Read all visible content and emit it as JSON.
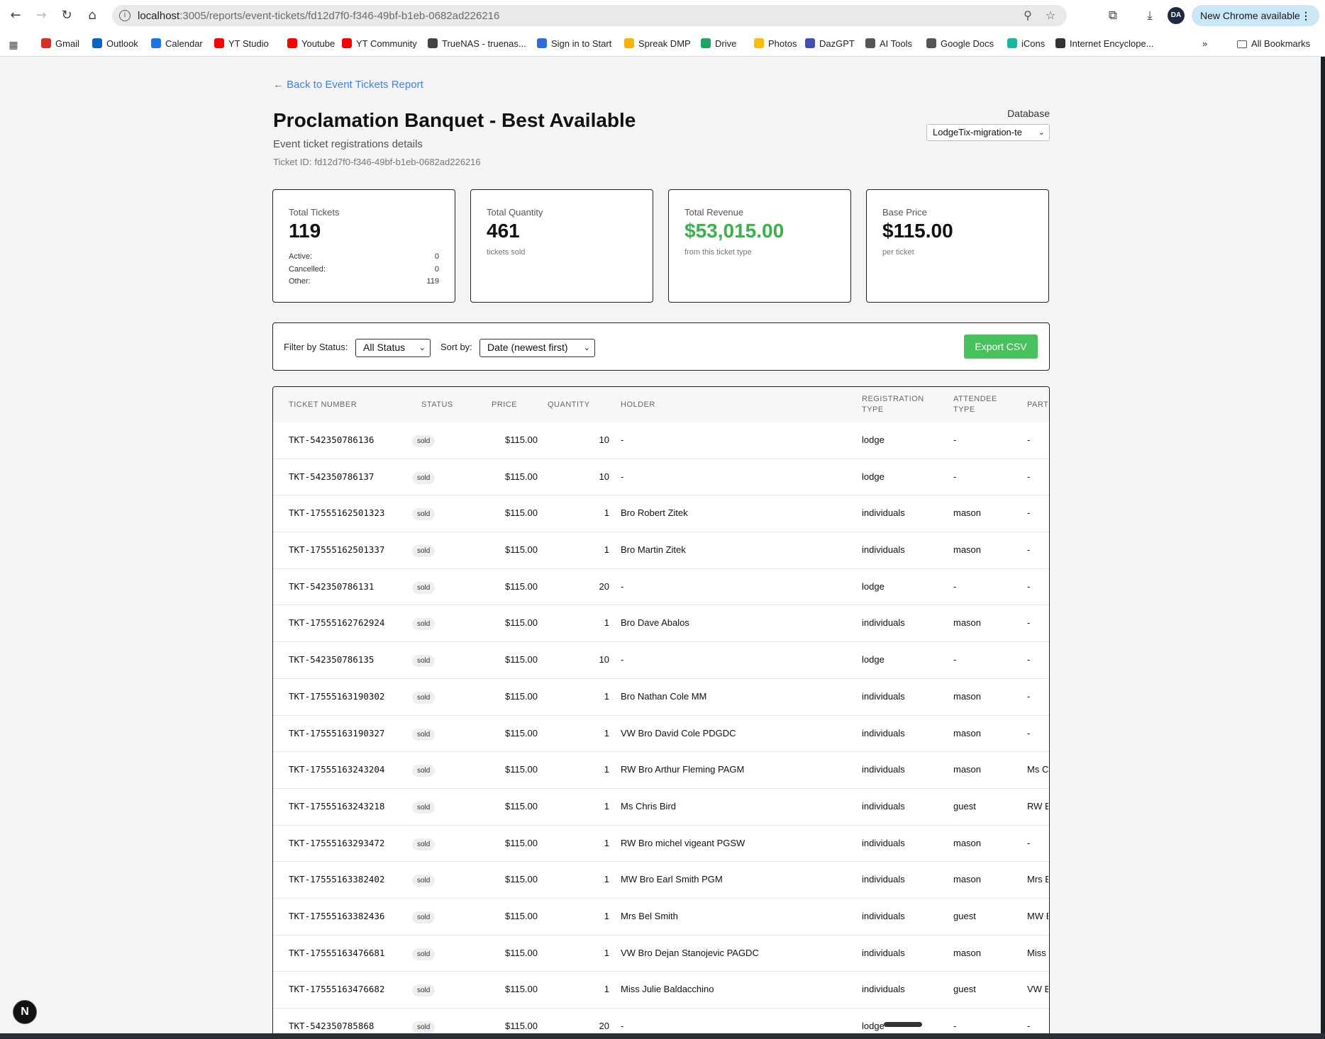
{
  "browser": {
    "url_host": "localhost",
    "url_path": ":3005/reports/event-tickets/fd12d7f0-f346-49bf-b1eb-0682ad226216",
    "update_label": "New Chrome available",
    "profile_initials": "DA"
  },
  "bookmarks": [
    {
      "label": "Gmail",
      "icon": "gmail-icon",
      "color": "#d93025"
    },
    {
      "label": "Outlook",
      "icon": "outlook-icon",
      "color": "#0a64c8"
    },
    {
      "label": "Calendar",
      "icon": "calendar-icon",
      "color": "#1a73e8"
    },
    {
      "label": "YT Studio",
      "icon": "youtube-studio-icon",
      "color": "#ff0000"
    },
    {
      "label": "Youtube",
      "icon": "youtube-icon",
      "color": "#ff0000"
    },
    {
      "label": "YT Community",
      "icon": "youtube-community-icon",
      "color": "#ff0000"
    },
    {
      "label": "TrueNAS - truenas...",
      "icon": "truenas-icon",
      "color": "#444444"
    },
    {
      "label": "Sign in to Start",
      "icon": "zoom-icon",
      "color": "#2d6cdf"
    },
    {
      "label": "Spreak DMP",
      "icon": "spreak-icon",
      "color": "#f5b400"
    },
    {
      "label": "Drive",
      "icon": "drive-icon",
      "color": "#1fa463"
    },
    {
      "label": "Photos",
      "icon": "photos-icon",
      "color": "#fbbc04"
    },
    {
      "label": "DazGPT",
      "icon": "dazgpt-icon",
      "color": "#3f51b5"
    },
    {
      "label": "AI Tools",
      "icon": "folder-icon",
      "color": "#555555"
    },
    {
      "label": "Google Docs",
      "icon": "folder-icon",
      "color": "#555555"
    },
    {
      "label": "iCons",
      "icon": "icons-icon",
      "color": "#18b8a0"
    },
    {
      "label": "Internet Encyclope...",
      "icon": "encyclopedia-icon",
      "color": "#333333"
    }
  ],
  "bookmarks_more": "»",
  "all_bookmarks": "All Bookmarks",
  "page": {
    "back_link": "← Back to Event Tickets Report",
    "title": "Proclamation Banquet - Best Available",
    "subtitle": "Event ticket registrations details",
    "ticket_id_label": "Ticket ID:",
    "ticket_id": "fd12d7f0-f346-49bf-b1eb-0682ad226216",
    "database_label": "Database",
    "database_value": "LodgeTix-migration-te"
  },
  "cards": {
    "total_tickets": {
      "label": "Total Tickets",
      "value": "119",
      "active_label": "Active:",
      "active": "0",
      "cancelled_label": "Cancelled:",
      "cancelled": "0",
      "other_label": "Other:",
      "other": "119"
    },
    "total_quantity": {
      "label": "Total Quantity",
      "value": "461",
      "sub": "tickets sold"
    },
    "total_revenue": {
      "label": "Total Revenue",
      "value": "$53,015.00",
      "sub": "from this ticket type",
      "color": "#38b24a"
    },
    "base_price": {
      "label": "Base Price",
      "value": "$115.00",
      "sub": "per ticket"
    }
  },
  "filters": {
    "status_label": "Filter by Status:",
    "status_value": "All Status",
    "sort_label": "Sort by:",
    "sort_value": "Date (newest first)",
    "export_label": "Export CSV",
    "export_color": "#46c15c"
  },
  "table": {
    "headers": {
      "ticket_number": "TICKET NUMBER",
      "status": "STATUS",
      "price": "PRICE",
      "quantity": "QUANTITY",
      "holder": "HOLDER",
      "registration_type_1": "REGISTRATION",
      "registration_type_2": "TYPE",
      "attendee_type_1": "ATTENDEE",
      "attendee_type_2": "TYPE",
      "partner": "PART"
    },
    "rows": [
      {
        "ticket": "TKT-542350786136",
        "status": "sold",
        "price": "$115.00",
        "qty": "10",
        "holder": "-",
        "reg": "lodge",
        "att": "-",
        "part": "-"
      },
      {
        "ticket": "TKT-542350786137",
        "status": "sold",
        "price": "$115.00",
        "qty": "10",
        "holder": "-",
        "reg": "lodge",
        "att": "-",
        "part": "-"
      },
      {
        "ticket": "TKT-17555162501323",
        "status": "sold",
        "price": "$115.00",
        "qty": "1",
        "holder": "Bro Robert Zitek",
        "reg": "individuals",
        "att": "mason",
        "part": "-"
      },
      {
        "ticket": "TKT-17555162501337",
        "status": "sold",
        "price": "$115.00",
        "qty": "1",
        "holder": "Bro Martin Zitek",
        "reg": "individuals",
        "att": "mason",
        "part": "-"
      },
      {
        "ticket": "TKT-542350786131",
        "status": "sold",
        "price": "$115.00",
        "qty": "20",
        "holder": "-",
        "reg": "lodge",
        "att": "-",
        "part": "-"
      },
      {
        "ticket": "TKT-17555162762924",
        "status": "sold",
        "price": "$115.00",
        "qty": "1",
        "holder": "Bro Dave Abalos",
        "reg": "individuals",
        "att": "mason",
        "part": "-"
      },
      {
        "ticket": "TKT-542350786135",
        "status": "sold",
        "price": "$115.00",
        "qty": "10",
        "holder": "-",
        "reg": "lodge",
        "att": "-",
        "part": "-"
      },
      {
        "ticket": "TKT-17555163190302",
        "status": "sold",
        "price": "$115.00",
        "qty": "1",
        "holder": "Bro Nathan Cole MM",
        "reg": "individuals",
        "att": "mason",
        "part": "-"
      },
      {
        "ticket": "TKT-17555163190327",
        "status": "sold",
        "price": "$115.00",
        "qty": "1",
        "holder": "VW Bro David Cole PDGDC",
        "reg": "individuals",
        "att": "mason",
        "part": "-"
      },
      {
        "ticket": "TKT-17555163243204",
        "status": "sold",
        "price": "$115.00",
        "qty": "1",
        "holder": "RW Bro Arthur Fleming PAGM",
        "reg": "individuals",
        "att": "mason",
        "part": "Ms C"
      },
      {
        "ticket": "TKT-17555163243218",
        "status": "sold",
        "price": "$115.00",
        "qty": "1",
        "holder": "Ms Chris Bird",
        "reg": "individuals",
        "att": "guest",
        "part": "RW B"
      },
      {
        "ticket": "TKT-17555163293472",
        "status": "sold",
        "price": "$115.00",
        "qty": "1",
        "holder": "RW Bro michel vigeant PGSW",
        "reg": "individuals",
        "att": "mason",
        "part": "-"
      },
      {
        "ticket": "TKT-17555163382402",
        "status": "sold",
        "price": "$115.00",
        "qty": "1",
        "holder": "MW Bro Earl Smith PGM",
        "reg": "individuals",
        "att": "mason",
        "part": "Mrs B"
      },
      {
        "ticket": "TKT-17555163382436",
        "status": "sold",
        "price": "$115.00",
        "qty": "1",
        "holder": "Mrs Bel Smith",
        "reg": "individuals",
        "att": "guest",
        "part": "MW B"
      },
      {
        "ticket": "TKT-17555163476681",
        "status": "sold",
        "price": "$115.00",
        "qty": "1",
        "holder": "VW Bro Dejan Stanojevic PAGDC",
        "reg": "individuals",
        "att": "mason",
        "part": "Miss"
      },
      {
        "ticket": "TKT-17555163476682",
        "status": "sold",
        "price": "$115.00",
        "qty": "1",
        "holder": "Miss Julie Baldacchino",
        "reg": "individuals",
        "att": "guest",
        "part": "VW B"
      },
      {
        "ticket": "TKT-542350785868",
        "status": "sold",
        "price": "$115.00",
        "qty": "20",
        "holder": "-",
        "reg": "lodge",
        "att": "-",
        "part": "-"
      }
    ]
  },
  "dev_badge": "N"
}
